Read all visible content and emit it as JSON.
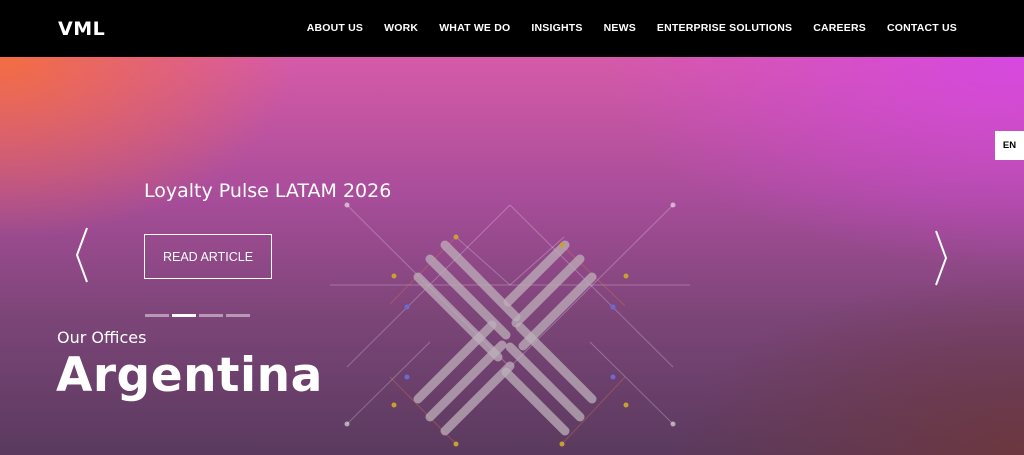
{
  "header": {
    "logo": "VML",
    "nav": [
      "ABOUT US",
      "WORK",
      "WHAT WE DO",
      "INSIGHTS",
      "NEWS",
      "ENTERPRISE SOLUTIONS",
      "CAREERS",
      "CONTACT US"
    ]
  },
  "language": "EN",
  "slider": {
    "title": "Loyalty Pulse LATAM 2026",
    "cta": "READ ARTICLE",
    "slide_count": 4,
    "active_index": 1
  },
  "office": {
    "label": "Our Offices",
    "name": "Argentina"
  },
  "colors": {
    "nav_bg": "#000000",
    "accent_orange": "#f56e3c",
    "accent_magenta": "#d746e6",
    "text": "#ffffff"
  }
}
